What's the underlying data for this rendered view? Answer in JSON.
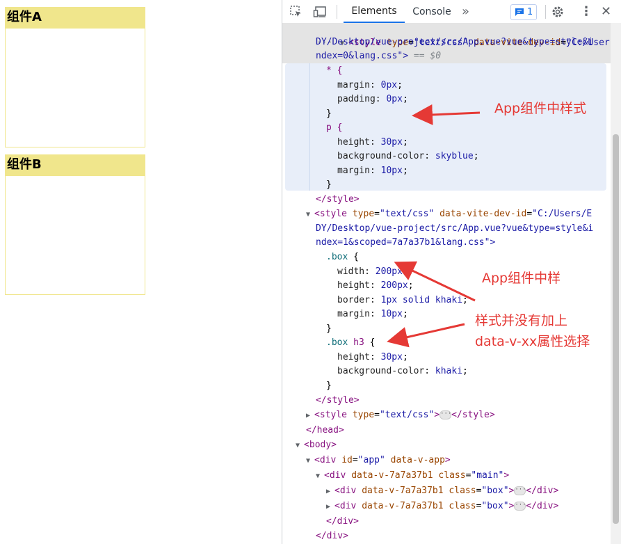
{
  "page": {
    "boxes": [
      {
        "heading": "组件A"
      },
      {
        "heading": "组件B"
      }
    ]
  },
  "devtools": {
    "tabs": [
      {
        "label": "Elements",
        "active": true
      },
      {
        "label": "Console",
        "active": false
      }
    ],
    "more_tabs_icon": "chevron-double-right-icon",
    "issues_badge": {
      "count": "1"
    },
    "icons": [
      "inspect-element-icon",
      "device-toolbar-icon",
      "issues-chat-icon",
      "gear-icon",
      "kebab-menu-icon",
      "close-icon"
    ],
    "colors": {
      "active_tab": "#1a73e8",
      "selection": "#e8eef9",
      "khaki": "#f0e68c",
      "annotation": "#e53935"
    },
    "code": {
      "l1": {
        "gutter": "···",
        "open": "<style",
        "a1": "type",
        "v1": "\"text/css\"",
        "a2": "data-vite-dev-id",
        "v2": "\"C:/Users/E"
      },
      "l2": "DY/Desktop/vue-project/src/App.vue?vue&type=style&i",
      "l3": {
        "text": "ndex=0&lang.css\">",
        "eq": "== $0"
      },
      "css1": [
        "* {",
        "margin: ",
        "0px",
        ";",
        "padding: ",
        "0px",
        ";",
        "}",
        "p {",
        "height: ",
        "30px",
        ";",
        "background-color: ",
        "skyblue",
        ";",
        "margin: ",
        "10px",
        ";",
        "}"
      ],
      "close_style": "</style>",
      "l_style2": {
        "open": "<style",
        "a1": "type",
        "v1": "\"text/css\"",
        "a2": "data-vite-dev-id",
        "v2": "\"C:/Users/E"
      },
      "l_style2b": "DY/Desktop/vue-project/src/App.vue?vue&type=style&i",
      "l_style2c": "ndex=1&scoped=7a7a37b1&lang.css\">",
      "css2": {
        "box_sel": ".box",
        "brace_open": " {",
        "width": "width: ",
        "w_val": "200px",
        "height": "height: ",
        "h_val": "200px",
        "border": "border: ",
        "b_val": "1px solid khaki",
        "margin": "margin: ",
        "m_val": "10px",
        "brace_close": "}",
        "h3_sel": ".box",
        "h3_tag": " h3",
        "h3_height": "height: ",
        "h3_h_val": "30px",
        "h3_bg": "background-color: ",
        "h3_bg_val": "khaki"
      },
      "style3": {
        "open": "<style",
        "a1": "type",
        "v1": "\"text/css\"",
        "close": "</style>"
      },
      "head_close": "</head>",
      "body_open": "<body>",
      "app_div": {
        "open": "<div",
        "a1": "id",
        "v1": "\"app\"",
        "a2": "data-v-app"
      },
      "main_div": {
        "open": "<div",
        "a1": "data-v-7a7a37b1",
        "a2": "class",
        "v2": "\"main\""
      },
      "box_div": {
        "open": "<div",
        "a1": "data-v-7a7a37b1",
        "a2": "class",
        "v2": "\"box\"",
        "close": "</div>"
      },
      "div_close": "</div>"
    }
  },
  "annotations": {
    "a1": "App组件中样式",
    "a2": "App组件中样",
    "a3_line1": "样式并没有加上",
    "a3_line2": "data-v-xx属性选择"
  }
}
